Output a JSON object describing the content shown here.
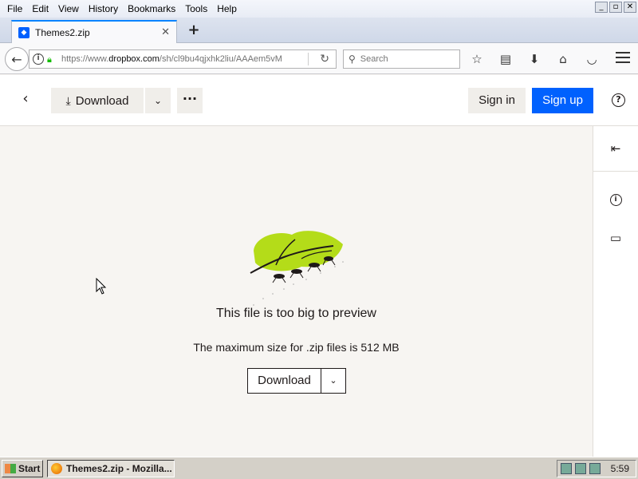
{
  "menubar": {
    "items": [
      {
        "label": "File"
      },
      {
        "label": "Edit"
      },
      {
        "label": "View"
      },
      {
        "label": "History"
      },
      {
        "label": "Bookmarks"
      },
      {
        "label": "Tools"
      },
      {
        "label": "Help"
      }
    ]
  },
  "tab": {
    "title": "Themes2.zip",
    "favicon": "dropbox-icon"
  },
  "nav": {
    "url_prefix": "https://www.",
    "url_domain": "dropbox.com",
    "url_path": "/sh/cl9bu4qjxhk2liu/AAAem5vM",
    "search_placeholder": "Search"
  },
  "header": {
    "download_label": "Download",
    "signin_label": "Sign in",
    "signup_label": "Sign up",
    "accent_color": "#0061fe"
  },
  "preview": {
    "title": "This file is too big to preview",
    "subtitle": "The maximum size for .zip files is 512 MB",
    "download_label": "Download"
  },
  "taskbar": {
    "start_label": "Start",
    "task_label": "Themes2.zip - Mozilla...",
    "clock": "5:59"
  }
}
